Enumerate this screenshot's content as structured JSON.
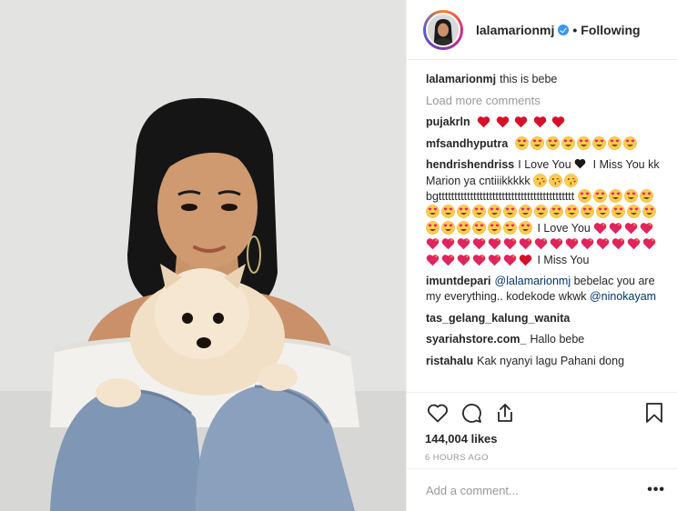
{
  "post": {
    "image_alt": "photo of a young woman holding a small cream Pomeranian puppy",
    "header": {
      "username": "lalamarionmj",
      "separator": "•",
      "follow_status": "Following"
    },
    "caption": {
      "username": "lalamarionmj",
      "text": "this is bebe"
    },
    "load_more": "Load more comments",
    "comments": [
      {
        "username": "pujakrln",
        "parts": []
      },
      {
        "username": "mfsandhyputra",
        "parts": []
      },
      {
        "username": "hendrishendriss",
        "text1": "I Love You",
        "text2": "I Miss You kk Marion ya cntiiikkkkk",
        "text3": "bgttttttttttttttttttttttttttttttttttttttttttt",
        "text4": "I Love You",
        "text5": "I Miss You"
      },
      {
        "username": "imuntdepari",
        "mention1": "@lalamarionmj",
        "text": "bebelac you are my everything.. kodekode wkwk",
        "mention2": "@ninokayam"
      },
      {
        "username": "tas_gelang_kalung_wanita"
      },
      {
        "username": "syariahstore.com_",
        "text": "Hallo bebe"
      },
      {
        "username": "ristahalu",
        "text": "Kak nyanyi lagu Pahani dong"
      }
    ],
    "likes": "144,004 likes",
    "timestamp": "6 HOURS AGO",
    "add_comment_placeholder": "Add a comment...",
    "more_options": "•••"
  },
  "icons": {
    "like": "heart-outline-icon",
    "comment": "speech-bubble-icon",
    "share": "share-icon",
    "save": "bookmark-icon",
    "verified": "verified-badge-icon"
  },
  "colors": {
    "verified_blue": "#3897f0",
    "mention_blue": "#003569",
    "muted_gray": "#999999",
    "heart_red": "#e0245e",
    "emoji_yellow": "#ffcc4d"
  }
}
